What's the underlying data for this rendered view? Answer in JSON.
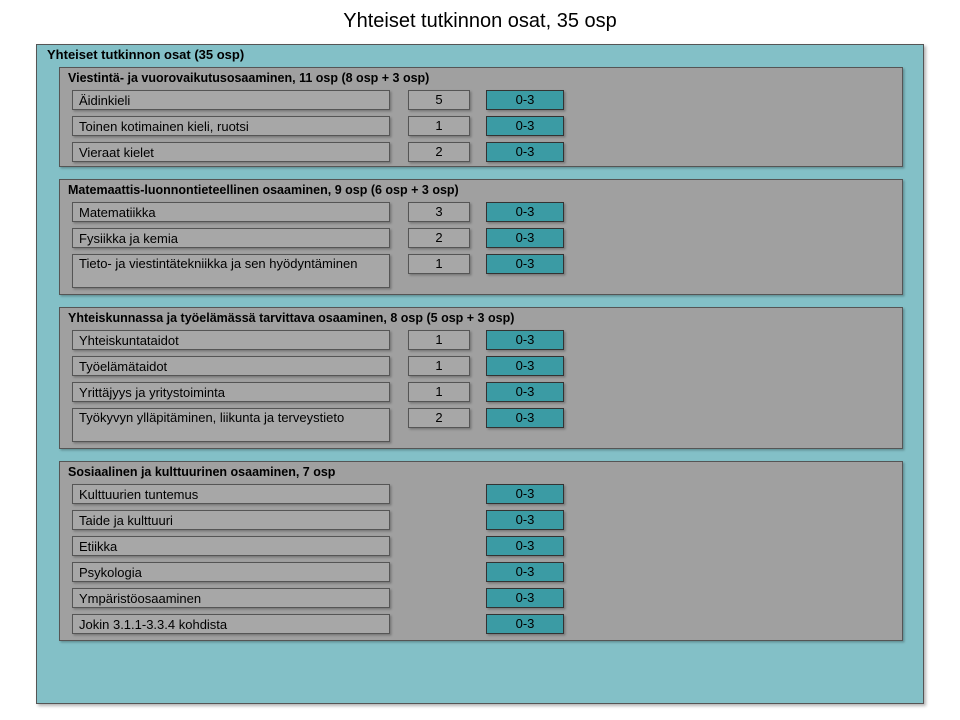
{
  "page_title": "Yhteiset tutkinnon osat, 35 osp",
  "outer_title": "Yhteiset tutkinnon osat (35 osp)",
  "sections": [
    {
      "title": "Viestintä- ja vuorovaikutusosaaminen, 11 osp (8 osp + 3 osp)",
      "rows": [
        {
          "label": "Äidinkieli",
          "num": "5",
          "range": "0-3"
        },
        {
          "label": "Toinen kotimainen kieli, ruotsi",
          "num": "1",
          "range": "0-3"
        },
        {
          "label": "Vieraat kielet",
          "num": "2",
          "range": "0-3"
        }
      ]
    },
    {
      "title": "Matemaattis-luonnontieteellinen osaaminen, 9 osp (6 osp + 3 osp)",
      "rows": [
        {
          "label": "Matematiikka",
          "num": "3",
          "range": "0-3"
        },
        {
          "label": "Fysiikka ja kemia",
          "num": "2",
          "range": "0-3"
        },
        {
          "label": "Tieto- ja viestintätekniikka ja sen hyödyntäminen",
          "num": "1",
          "range": "0-3",
          "tall": true
        }
      ]
    },
    {
      "title": "Yhteiskunnassa ja työelämässä tarvittava osaaminen, 8 osp (5 osp + 3 osp)",
      "rows": [
        {
          "label": "Yhteiskuntataidot",
          "num": "1",
          "range": "0-3"
        },
        {
          "label": "Työelämätaidot",
          "num": "1",
          "range": "0-3"
        },
        {
          "label": "Yrittäjyys ja yritystoiminta",
          "num": "1",
          "range": "0-3"
        },
        {
          "label": "Työkyvyn ylläpitäminen, liikunta ja terveystieto",
          "num": "2",
          "range": "0-3",
          "tall": true
        }
      ]
    },
    {
      "title": "Sosiaalinen ja kulttuurinen osaaminen, 7 osp",
      "rows": [
        {
          "label": "Kulttuurien tuntemus",
          "range": "0-3"
        },
        {
          "label": "Taide ja kulttuuri",
          "range": "0-3"
        },
        {
          "label": "Etiikka",
          "range": "0-3"
        },
        {
          "label": "Psykologia",
          "range": "0-3"
        },
        {
          "label": "Ympäristöosaaminen",
          "range": "0-3"
        },
        {
          "label": "Jokin 3.1.1-3.3.4 kohdista",
          "range": "0-3"
        }
      ]
    }
  ]
}
